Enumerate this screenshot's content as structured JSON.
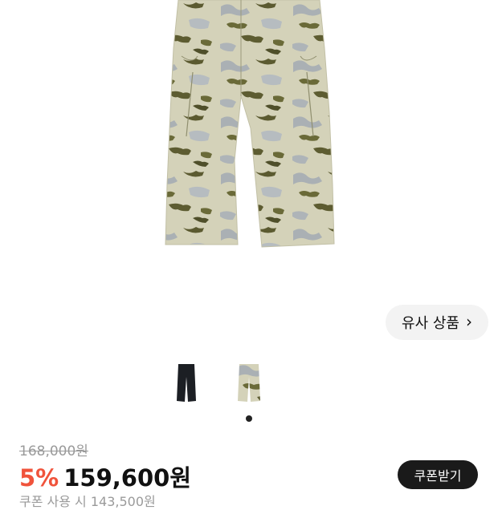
{
  "product_image": {
    "alt": "camouflage cargo pants"
  },
  "similar_products": {
    "label": "유사 상품",
    "icon": "chevron-right-icon",
    "chevron": "›"
  },
  "color_options": [
    {
      "name": "black",
      "color": "#1c1f24"
    },
    {
      "name": "camo",
      "color": "#c7c4a8"
    }
  ],
  "carousel": {
    "active_index": 0,
    "count": 1
  },
  "pricing": {
    "original_price": "168,000원",
    "discount_rate": "5%",
    "sale_price": "159,600원",
    "coupon_button_label": "쿠폰받기",
    "coupon_note": "쿠폰 사용 시 143,500원"
  },
  "colors": {
    "accent": "#f0533b",
    "button_dark": "#1a1a1a",
    "pill_bg": "#f3f3f3"
  }
}
